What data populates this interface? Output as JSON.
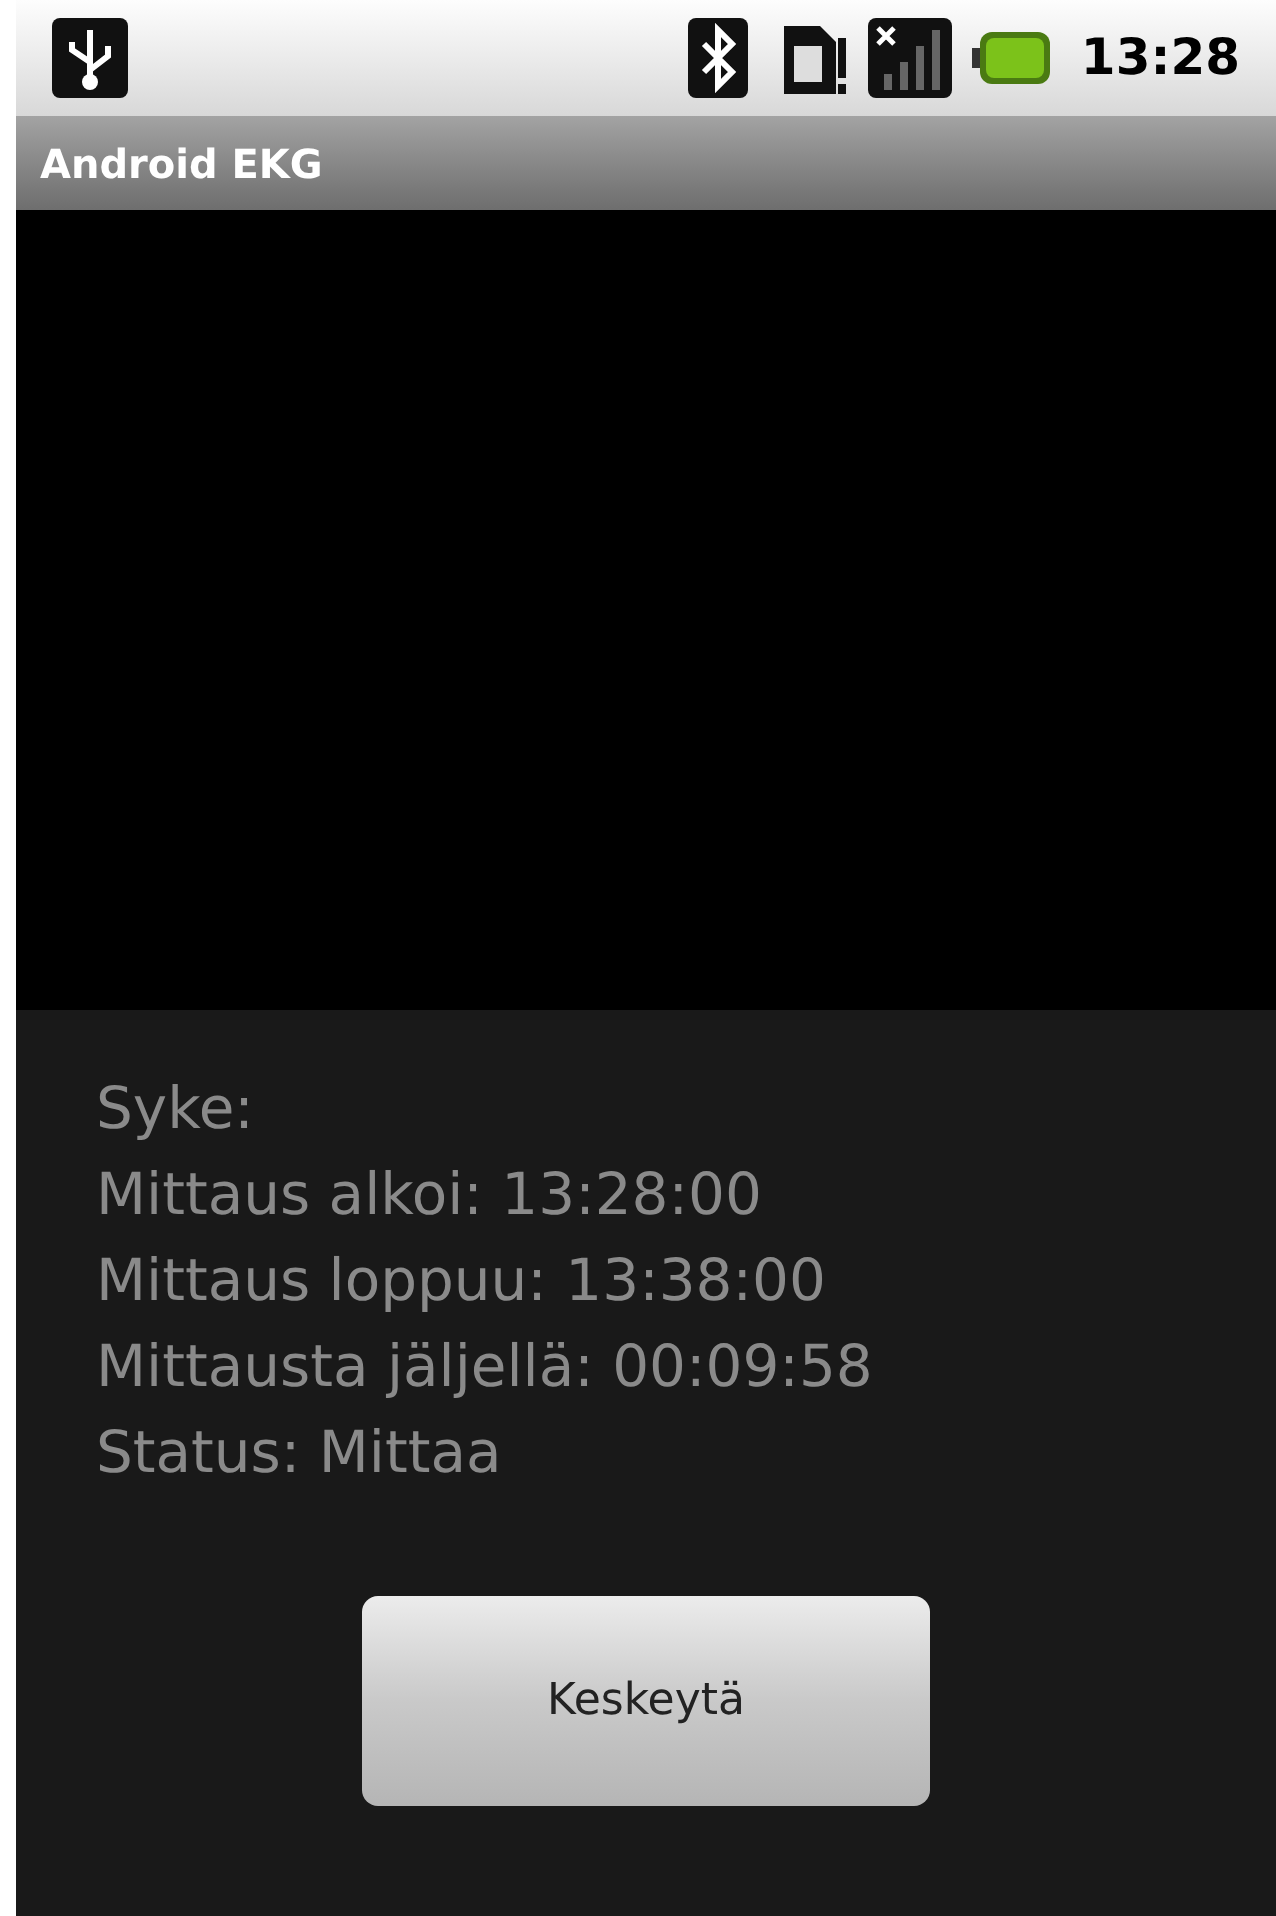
{
  "status_bar": {
    "time": "13:28"
  },
  "title_bar": {
    "title": "Android EKG"
  },
  "info_lines": [
    "Syke:",
    "Mittaus alkoi: 13:28:00",
    "Mittaus loppuu: 13:38:00",
    "Mittausta jäljellä: 00:09:58",
    "Status: Mittaa"
  ],
  "buttons": [
    "Keskeytä"
  ]
}
